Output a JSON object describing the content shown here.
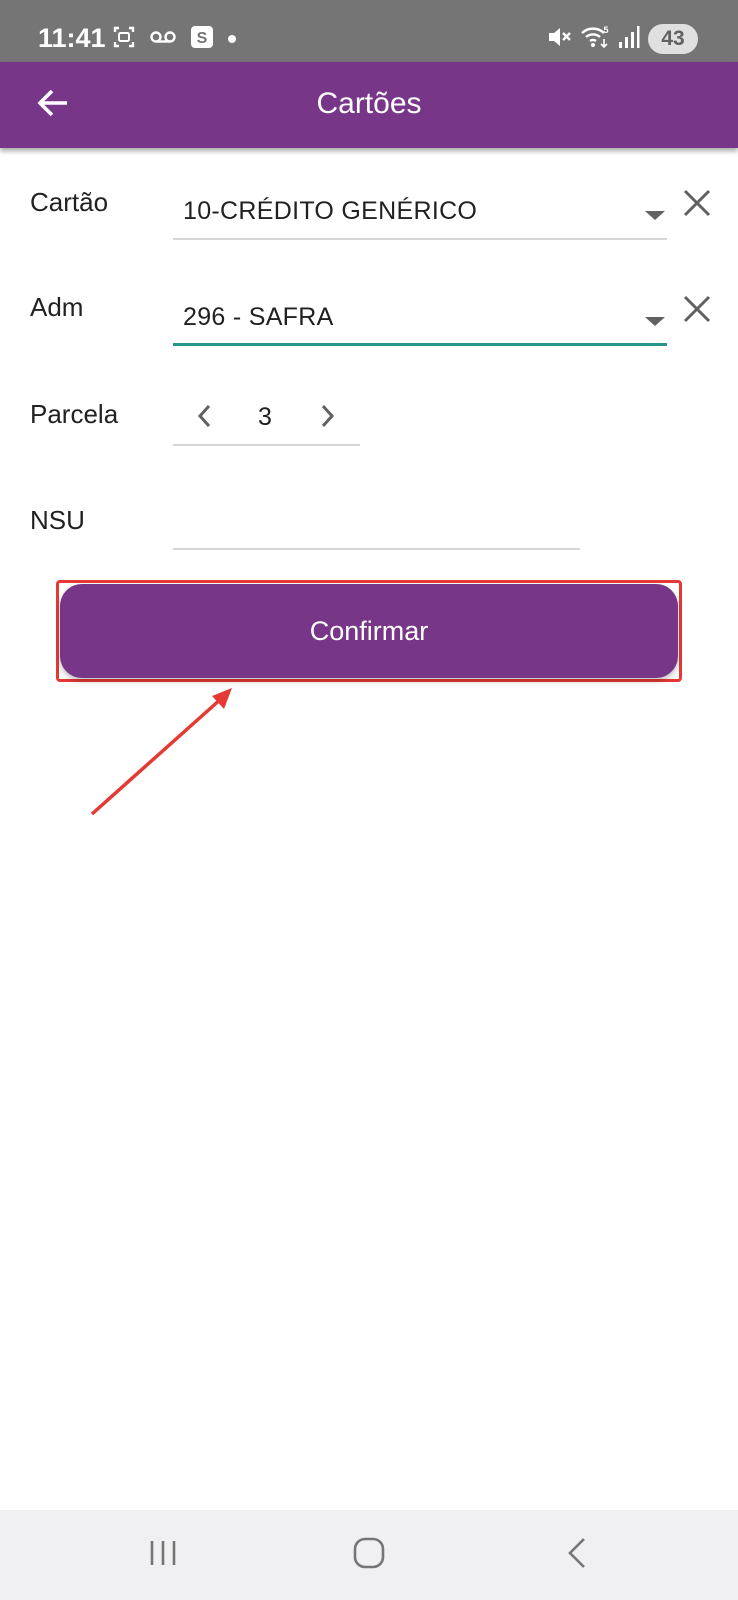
{
  "status_bar": {
    "time": "11:41",
    "battery": "43",
    "left_icons": [
      "screenshot-icon",
      "voicemail-icon",
      "s-app-icon",
      "notification-dot"
    ],
    "right_icons": [
      "mute-icon",
      "wifi-icon",
      "signal-icon"
    ]
  },
  "app_bar": {
    "title": "Cartões",
    "back_icon": "arrow-left-icon",
    "color": "#773688"
  },
  "form": {
    "cartao": {
      "label": "Cartão",
      "value": "10-CRÉDITO GENÉRICO"
    },
    "adm": {
      "label": "Adm",
      "value": "296 - SAFRA",
      "focused": true
    },
    "parcela": {
      "label": "Parcela",
      "value": "3"
    },
    "nsu": {
      "label": "NSU",
      "value": ""
    }
  },
  "confirm_button": {
    "label": "Confirmar",
    "highlighted": true,
    "highlight_color": "#e53935"
  },
  "nav_bar": {
    "items": [
      "recents-icon",
      "home-icon",
      "back-icon"
    ]
  },
  "colors": {
    "primary": "#773688",
    "accent": "#26968a"
  }
}
